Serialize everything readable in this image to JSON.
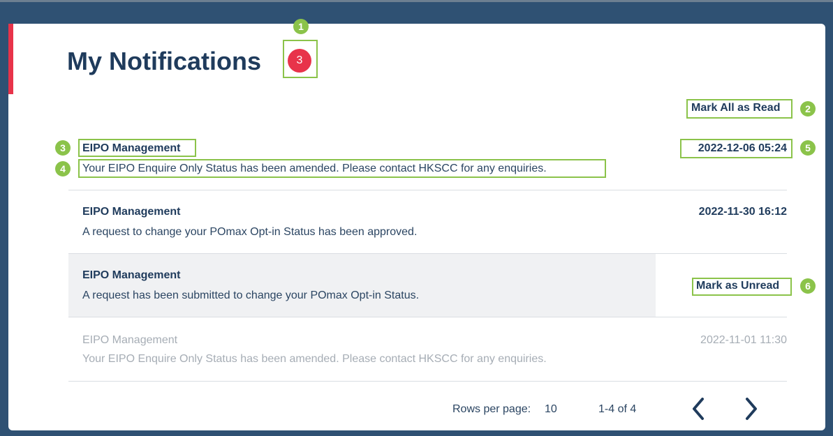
{
  "header": {
    "title": "My Notifications",
    "unread_count": "3"
  },
  "actions": {
    "mark_all_read": "Mark All as Read",
    "mark_as_unread": "Mark as Unread"
  },
  "callouts": [
    "1",
    "2",
    "3",
    "4",
    "5",
    "6"
  ],
  "notifications": [
    {
      "source": "EIPO Management",
      "message": "Your EIPO Enquire Only Status has been amended. Please contact HKSCC for any enquiries.",
      "time": "2022-12-06 05:24",
      "state": "unread"
    },
    {
      "source": "EIPO Management",
      "message": "A request to change your POmax Opt-in Status has been approved.",
      "time": "2022-11-30 16:12",
      "state": "unread"
    },
    {
      "source": "EIPO Management",
      "message": "A request has been submitted to change your POmax Opt-in Status.",
      "time": "",
      "state": "unread-hover"
    },
    {
      "source": "EIPO Management",
      "message": "Your EIPO Enquire Only Status has been amended. Please contact HKSCC for any enquiries.",
      "time": "2022-11-01 11:30",
      "state": "read"
    }
  ],
  "pagination": {
    "rows_per_page_label": "Rows per page:",
    "rows_per_page_value": "10",
    "range": "1-4 of 4",
    "prev_icon": "chevron-left-icon",
    "next_icon": "chevron-right-icon"
  },
  "colors": {
    "background": "#2f5173",
    "accent": "#e8334a",
    "callout": "#8bc34a",
    "text": "#1f3b5c",
    "read_text": "#a6adb5"
  }
}
